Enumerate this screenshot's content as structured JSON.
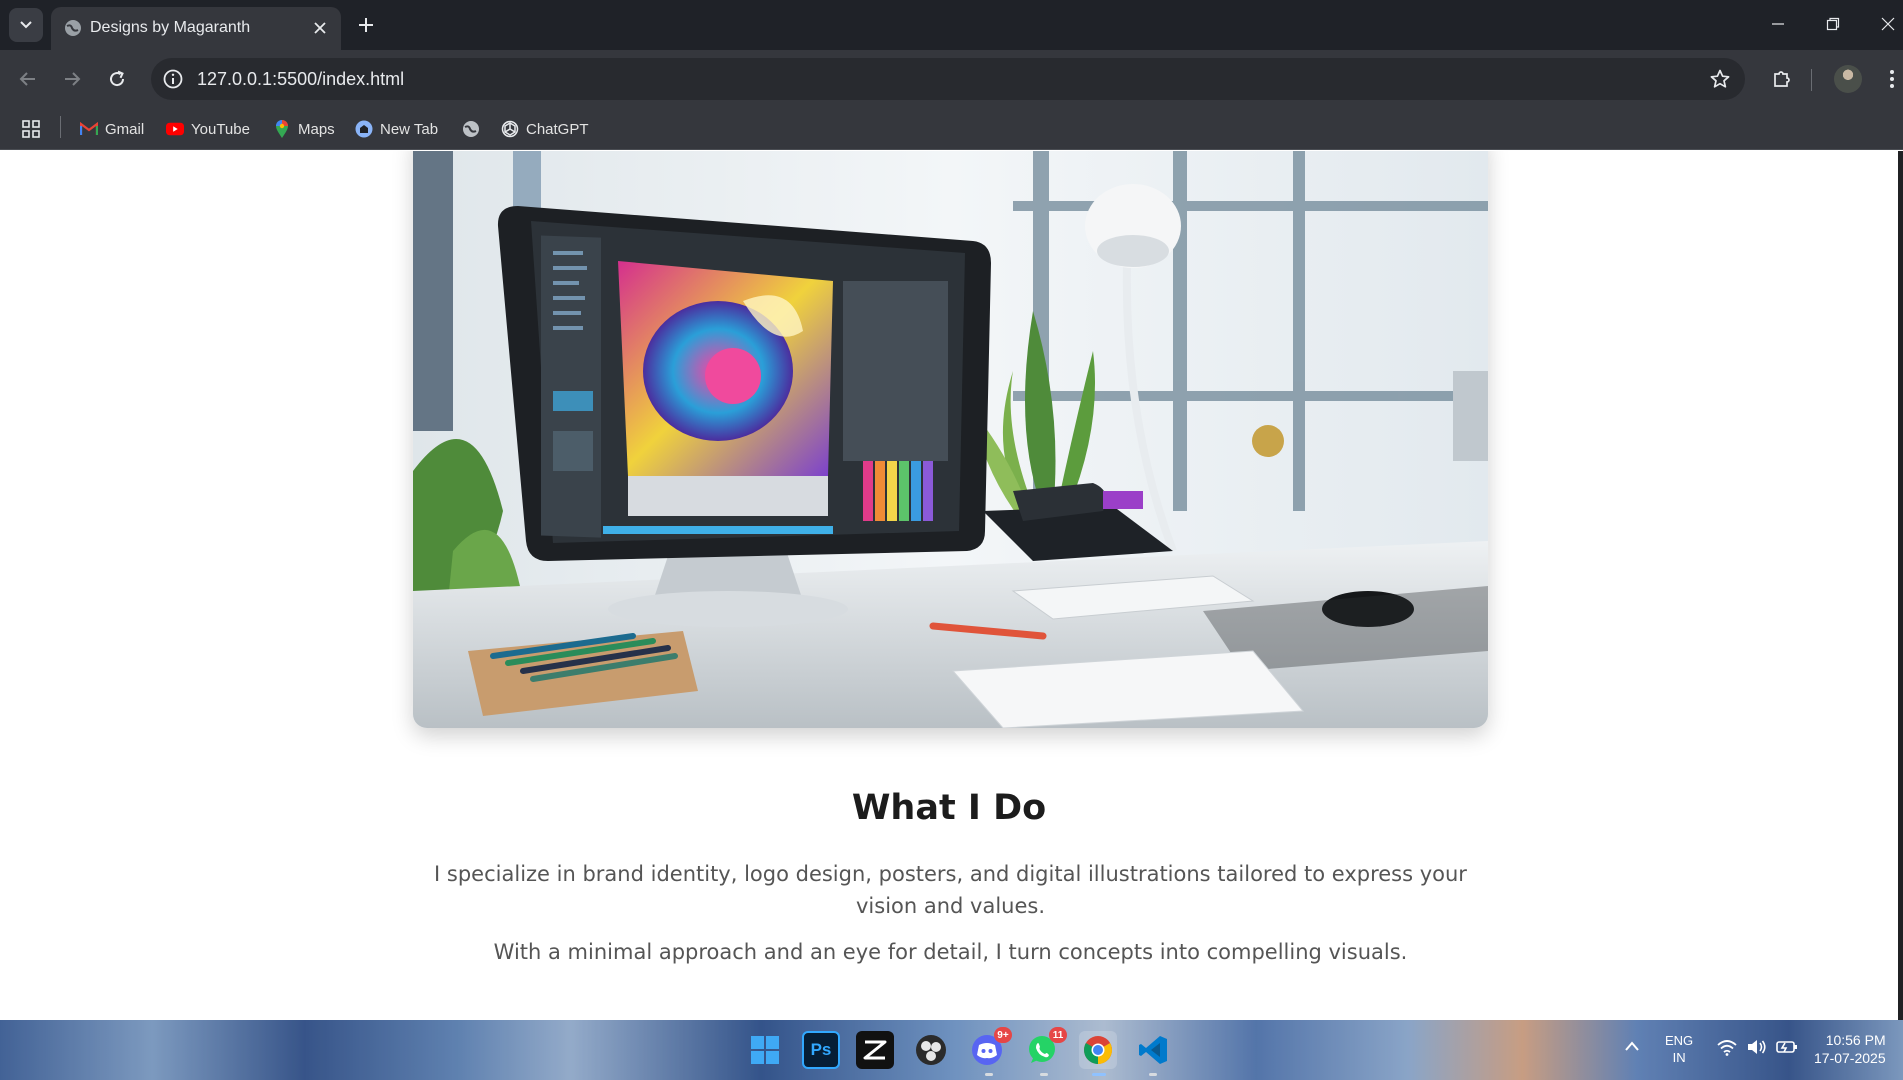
{
  "browser": {
    "tab_title": "Designs by Magaranth",
    "url": "127.0.0.1:5500/index.html",
    "bookmarks": [
      {
        "label": "Gmail",
        "icon": "gmail-icon"
      },
      {
        "label": "YouTube",
        "icon": "youtube-icon"
      },
      {
        "label": "Maps",
        "icon": "maps-icon"
      },
      {
        "label": "New Tab",
        "icon": "new-tab-icon"
      },
      {
        "label": "",
        "icon": "globe-icon"
      },
      {
        "label": "ChatGPT",
        "icon": "chatgpt-icon"
      }
    ]
  },
  "page": {
    "hero_alt": "Designer workstation with monitor showing illustration",
    "section_title": "What I Do",
    "paragraph_1": "I specialize in brand identity, logo design, posters, and digital illustrations tailored to express your vision and values.",
    "paragraph_2": "With a minimal approach and an eye for detail, I turn concepts into compelling visuals."
  },
  "taskbar": {
    "apps": [
      {
        "name": "windows-start",
        "badge": ""
      },
      {
        "name": "photoshop",
        "label": "Ps",
        "badge": ""
      },
      {
        "name": "capcut",
        "badge": ""
      },
      {
        "name": "obs",
        "badge": ""
      },
      {
        "name": "discord",
        "badge": "9+"
      },
      {
        "name": "whatsapp",
        "badge": "11"
      },
      {
        "name": "chrome",
        "badge": ""
      },
      {
        "name": "vscode",
        "badge": ""
      }
    ],
    "language_top": "ENG",
    "language_bottom": "IN",
    "time": "10:56 PM",
    "date": "17-07-2025"
  },
  "colors": {
    "chrome_dark": "#1f2228",
    "chrome_toolbar": "#35373d",
    "heading": "#1c1c1c",
    "body_text": "#555555"
  }
}
